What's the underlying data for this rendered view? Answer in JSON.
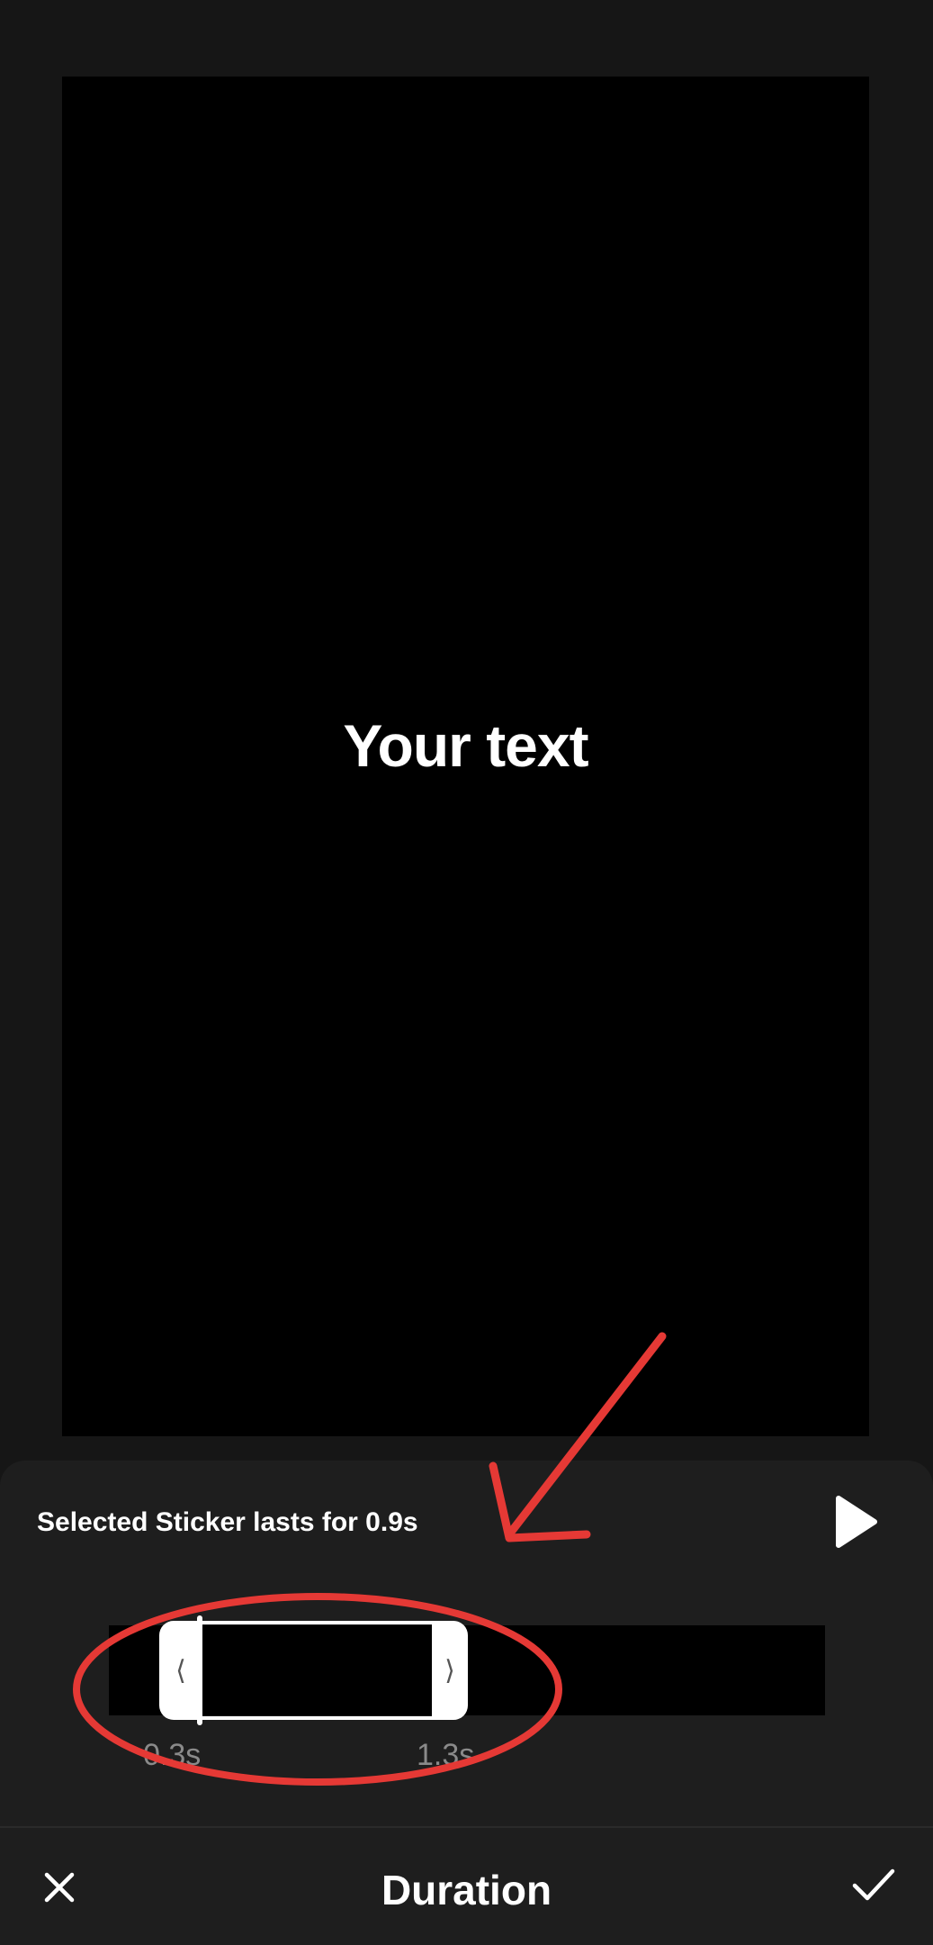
{
  "preview": {
    "text": "Your text"
  },
  "panel": {
    "duration_text": "Selected Sticker lasts for 0.9s",
    "play_icon": "play-icon",
    "trim": {
      "start_label": "0.3s",
      "end_label": "1.3s",
      "left_handle_glyph": "⟨",
      "right_handle_glyph": "⟩"
    }
  },
  "bottom_bar": {
    "title": "Duration",
    "close_icon": "close-icon",
    "confirm_icon": "checkmark-icon"
  },
  "colors": {
    "background": "#161616",
    "panel": "#1e1e1e",
    "annotation_red": "#e53935",
    "time_label": "#8a8a8a"
  }
}
